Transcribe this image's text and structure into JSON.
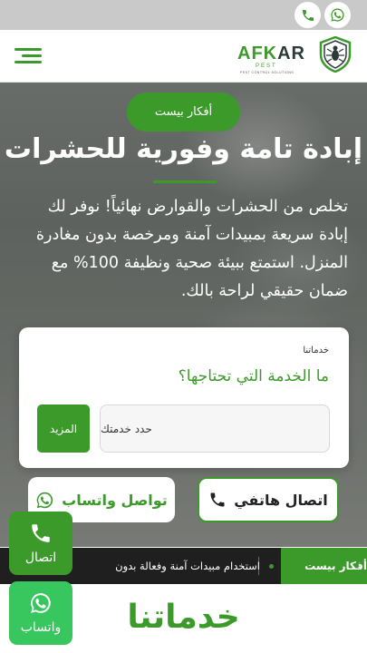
{
  "brand": {
    "name_green": "AFK",
    "name_dark": "AR",
    "sub": "PEST",
    "tagline": "PEST CONTROL SOLUTIONS"
  },
  "hero": {
    "badge": "أفكار بيست",
    "title": "إبادة تامة وفورية للحشرات",
    "description": "تخلص من الحشرات والقوارض نهائياً! نوفر لك إبادة سريعة بمبيدات آمنة ومرخصة بدون مغادرة المنزل. استمتع ببيئة صحية ونظيفة 100% مع ضمان حقيقي لراحة بالك."
  },
  "service_form": {
    "label": "خدماتنا",
    "question": "ما الخدمة التي تحتاجها؟",
    "select_value": "حدد خدمتك",
    "more_button": "المزيد"
  },
  "cta": {
    "call_label": "اتصال هاتفي",
    "whatsapp_label": "تواصل واتساب"
  },
  "ticker": {
    "tag": "أفكار بيست",
    "text": "استخدام مبيدات آمنة وفعالة بدون"
  },
  "services_section": {
    "title": "خدماتنا"
  },
  "floating": {
    "call_label": "اتصال",
    "whatsapp_label": "واتساب"
  },
  "colors": {
    "brand_green": "#3c9a2b",
    "whatsapp_green": "#38c75f"
  }
}
